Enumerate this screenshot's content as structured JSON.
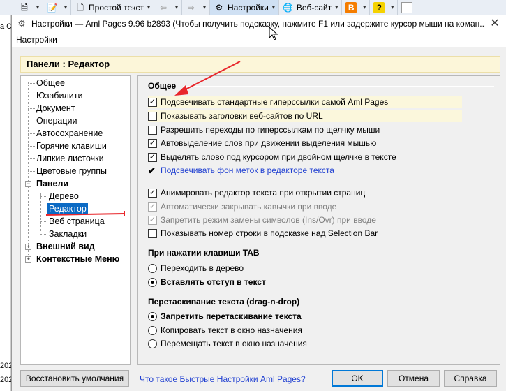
{
  "background_toolbar": {
    "items": [
      {
        "icon": "page-search-icon",
        "label": ""
      },
      {
        "icon": "notes-icon",
        "label": ""
      },
      {
        "icon": "page-icon",
        "label": "Простой текст"
      },
      {
        "icon": "arrow-left-icon",
        "label": ""
      },
      {
        "icon": "arrow-right-icon",
        "label": ""
      },
      {
        "icon": "gear-icon",
        "label": "Настройки"
      },
      {
        "icon": "globe-icon",
        "label": "Веб-сайт"
      },
      {
        "icon": "blogger-icon",
        "label": ""
      },
      {
        "icon": "help-icon",
        "label": ""
      },
      {
        "icon": "blank-icon",
        "label": ""
      }
    ],
    "left_fragments": [
      "а С",
      "202",
      "202"
    ]
  },
  "dialog": {
    "title": "Настройки — Aml Pages 9.96 b2893 (Чтобы получить подсказку, нажмите F1 или задержите курсор мыши на коман...",
    "close_glyph": "✕",
    "menu": [
      "Настройки"
    ],
    "panel_header": "Панели : Редактор"
  },
  "tree": {
    "items": [
      {
        "label": "Общее",
        "level": 0,
        "bold": false
      },
      {
        "label": "Юзабилити",
        "level": 0,
        "bold": false
      },
      {
        "label": "Документ",
        "level": 0,
        "bold": false
      },
      {
        "label": "Операции",
        "level": 0,
        "bold": false
      },
      {
        "label": "Автосохранение",
        "level": 0,
        "bold": false
      },
      {
        "label": "Горячие клавиши",
        "level": 0,
        "bold": false
      },
      {
        "label": "Липкие листочки",
        "level": 0,
        "bold": false
      },
      {
        "label": "Цветовые группы",
        "level": 0,
        "bold": false
      },
      {
        "label": "Панели",
        "level": 0,
        "bold": true,
        "expander": "−"
      },
      {
        "label": "Дерево",
        "level": 1,
        "bold": false
      },
      {
        "label": "Редактор",
        "level": 1,
        "bold": false,
        "selected": true
      },
      {
        "label": "Веб страница",
        "level": 1,
        "bold": false
      },
      {
        "label": "Закладки",
        "level": 1,
        "bold": false
      },
      {
        "label": "Внешний вид",
        "level": 0,
        "bold": true,
        "expander": "+"
      },
      {
        "label": "Контекстные Меню",
        "level": 0,
        "bold": true,
        "expander": "+"
      }
    ]
  },
  "settings": {
    "general_title": "Общее",
    "checkboxes": [
      {
        "label": "Подсвечивать стандартные гиперссылки самой Aml Pages",
        "checked": true,
        "disabled": false,
        "highlight": true
      },
      {
        "label": "Показывать заголовки веб-сайтов по URL",
        "checked": false,
        "disabled": false,
        "highlight": true
      },
      {
        "label": "Разрешить переходы по гиперссылкам по щелчку мыши",
        "checked": false,
        "disabled": false
      },
      {
        "label": "Автовыделение слов при движении выделения мышью",
        "checked": true,
        "disabled": false
      },
      {
        "label": "Выделять слово под курсором при двойном щелчке в тексте",
        "checked": true,
        "disabled": false
      },
      {
        "label": "Подсвечивать фон меток в редакторе текста",
        "checked": true,
        "disabled": false,
        "style": "tick-blue"
      },
      {
        "label": "Анимировать редактор текста при открытии страниц",
        "checked": true,
        "disabled": false
      },
      {
        "label": "Автоматически закрывать кавычки при вводе",
        "checked": true,
        "disabled": true
      },
      {
        "label": "Запретить режим замены символов (Ins/Ovr) при вводе",
        "checked": true,
        "disabled": true
      },
      {
        "label": "Показывать номер строки в подсказке над Selection Bar",
        "checked": false,
        "disabled": false
      }
    ],
    "tab_title": "При нажатии клавиши TAB",
    "tab_options": [
      {
        "label": "Переходить в дерево",
        "selected": false
      },
      {
        "label": "Вставлять отступ в текст",
        "selected": true
      }
    ],
    "drag_title": "Перетаскивание текста (drag-n-drop)",
    "drag_options": [
      {
        "label": "Запретить перетаскивание текста",
        "selected": true
      },
      {
        "label": "Копировать текст в окно назначения",
        "selected": false
      },
      {
        "label": "Перемещать текст в окно назначения",
        "selected": false
      }
    ]
  },
  "footer": {
    "restore_label": "Восстановить умолчания",
    "help_link": "Что такое Быстрые Настройки Aml Pages?",
    "ok_label": "OK",
    "cancel_label": "Отмена",
    "help_label": "Справка"
  },
  "colors": {
    "selection": "#0b6ac4",
    "header_bg": "#fcf6d9",
    "highlight_bg": "#fbf7dc",
    "link": "#1f3fd1",
    "annotation_arrow": "#e8262b"
  }
}
